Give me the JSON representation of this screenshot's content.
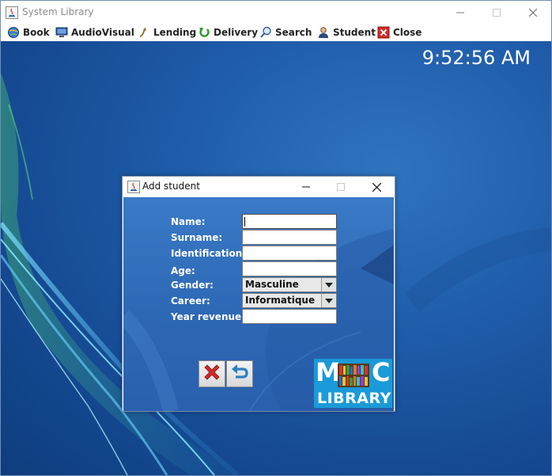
{
  "main_window": {
    "title": "System Library",
    "menu": [
      {
        "label": "Book",
        "icon": "globe-book-icon"
      },
      {
        "label": "AudioVisual",
        "icon": "monitor-icon"
      },
      {
        "label": "Lending",
        "icon": "arrow-curve-icon"
      },
      {
        "label": "Delivery",
        "icon": "green-return-icon"
      },
      {
        "label": "Search",
        "icon": "magnifier-icon"
      },
      {
        "label": "Student",
        "icon": "person-icon"
      },
      {
        "label": "Close",
        "icon": "red-x-icon"
      }
    ],
    "clock": "9:52:56 AM"
  },
  "dialog": {
    "title": "Add student",
    "fields": {
      "name_label": "Name:",
      "surname_label": "Surname:",
      "identification_label": "Identification:",
      "age_label": "Age:",
      "gender_label": "Gender:",
      "career_label": "Career:",
      "year_revenue_label": "Year revenue:"
    },
    "values": {
      "name": "",
      "surname": "",
      "identification": "",
      "age": "",
      "gender": "Masculine",
      "career": "Informatique",
      "year_revenue": ""
    },
    "buttons": {
      "cancel_icon": "red-x-icon",
      "back_icon": "undo-arrow-icon"
    },
    "logo": {
      "letter_m": "M",
      "letter_c": "C",
      "word": "LIBRARY"
    }
  },
  "colors": {
    "desktop": "#1e5ba8",
    "dialog_body": "#3470bd",
    "logo_bg": "#1a9ad8",
    "close_red": "#d42a2a"
  }
}
